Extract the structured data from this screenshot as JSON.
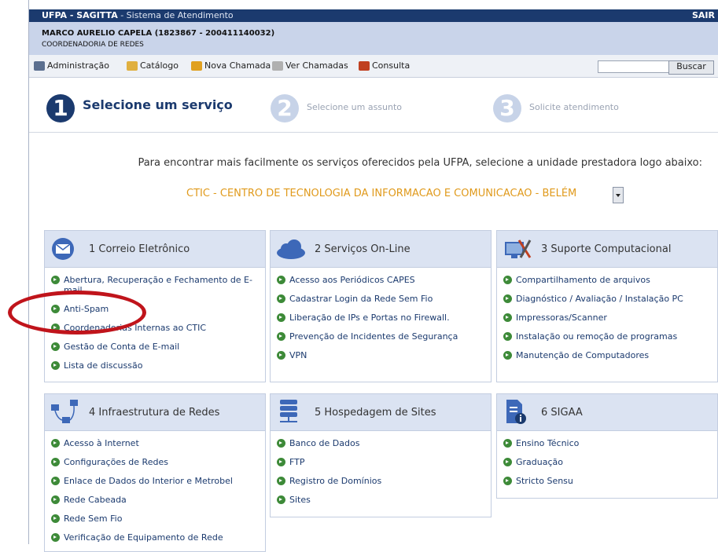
{
  "titlebar": {
    "app": "UFPA - SAGITTA",
    "subtitle": " - Sistema de Atendimento",
    "exit": "SAIR"
  },
  "user": {
    "name": "MARCO AURELIO CAPELA (1823867 - 200411140032)",
    "department": "COORDENADORIA DE REDES"
  },
  "menu": [
    {
      "label": "Administração",
      "icon": "admin-icon",
      "color": "#5b6f8f"
    },
    {
      "label": "Catálogo",
      "icon": "book-icon",
      "color": "#e0b040"
    },
    {
      "label": "Nova Chamada",
      "icon": "pencil-icon",
      "color": "#e0a020"
    },
    {
      "label": "Ver Chamadas",
      "icon": "trophy-icon",
      "color": "#b0b0b0"
    },
    {
      "label": "Consulta",
      "icon": "magnifier-icon",
      "color": "#c04020"
    }
  ],
  "search": {
    "value": "",
    "button": "Buscar"
  },
  "steps": [
    {
      "num": "1",
      "label": "Selecione um serviço"
    },
    {
      "num": "2",
      "label": "Selecione um assunto"
    },
    {
      "num": "3",
      "label": "Solicite atendimento"
    }
  ],
  "instruction": "Para encontrar mais facilmente os serviços oferecidos pela UFPA, selecione a unidade prestadora logo abaixo:",
  "unit": {
    "selected": "CTIC - CENTRO DE TECNOLOGIA DA INFORMACAO E COMUNICACAO - BELÉM",
    "color": "#e09a1c"
  },
  "cards": [
    {
      "title": "1 Correio Eletrônico",
      "icon": "envelope-icon",
      "items": [
        "Abertura, Recuperação e Fechamento de E-mail",
        "Anti-Spam",
        "Coordenadorias Internas ao CTIC",
        "Gestão de Conta de E-mail",
        "Lista de discussão"
      ]
    },
    {
      "title": "2 Serviços On-Line",
      "icon": "cloud-icon",
      "items": [
        "Acesso aos Periódicos CAPES",
        "Cadastrar Login da Rede Sem Fio",
        "Liberação de IPs e Portas no Firewall.",
        "Prevenção de Incidentes de Segurança",
        "VPN"
      ]
    },
    {
      "title": "3 Suporte Computacional",
      "icon": "computer-tools-icon",
      "items": [
        "Compartilhamento de arquivos",
        "Diagnóstico / Avaliação / Instalação PC",
        "Impressoras/Scanner",
        "Instalação ou remoção de programas",
        "Manutenção de Computadores"
      ]
    },
    {
      "title": "4 Infraestrutura de Redes",
      "icon": "network-icon",
      "items": [
        "Acesso à Internet",
        "Configurações de Redes",
        "Enlace de Dados do Interior e Metrobel",
        "Rede Cabeada",
        "Rede Sem Fio",
        "Verificação de Equipamento de Rede"
      ]
    },
    {
      "title": "5 Hospedagem de Sites",
      "icon": "server-icon",
      "items": [
        "Banco de Dados",
        "FTP",
        "Registro de Domínios",
        "Sites"
      ]
    },
    {
      "title": "6 SIGAA",
      "icon": "document-info-icon",
      "items": [
        "Ensino Técnico",
        "Graduação",
        "Stricto Sensu"
      ]
    }
  ],
  "colors": {
    "header_bg": "#1b3a6e",
    "user_bg": "#c9d4ea",
    "card_head_bg": "#dbe3f2",
    "link": "#1b3a6e",
    "bullet": "#3d8a38",
    "annotation": "#c0141b"
  }
}
